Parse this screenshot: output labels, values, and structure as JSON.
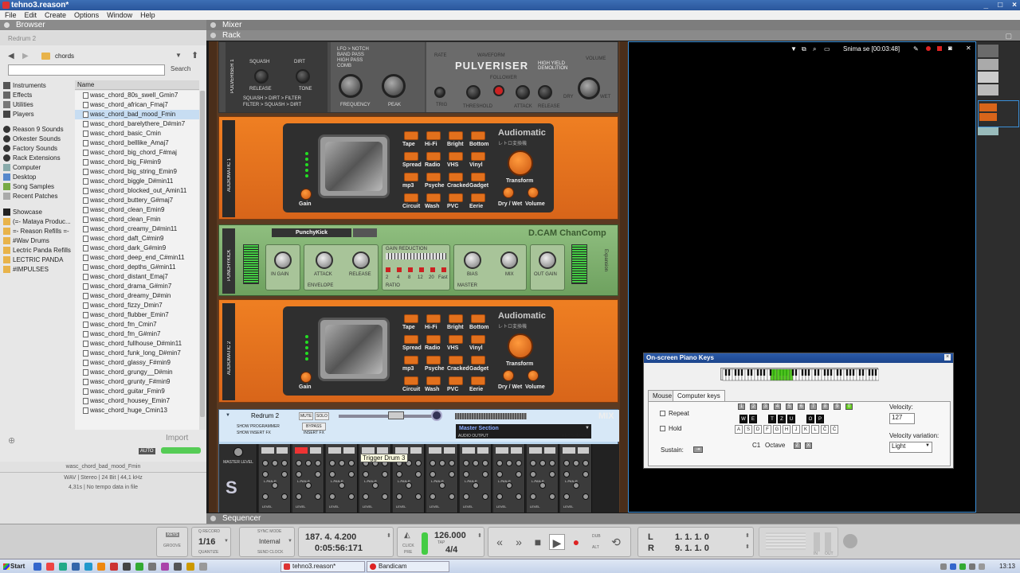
{
  "window": {
    "title": "tehno3.reason*",
    "controls": [
      "_",
      "□",
      "×"
    ]
  },
  "menu": [
    "File",
    "Edit",
    "Create",
    "Options",
    "Window",
    "Help"
  ],
  "browser": {
    "header": "Browser",
    "device_name": "Redrum 2",
    "current_folder": "chords",
    "search_placeholder": "",
    "search_label": "Search",
    "locations": [
      {
        "label": "Instruments",
        "icon": "instruments-icon"
      },
      {
        "label": "Effects",
        "icon": "effects-icon"
      },
      {
        "label": "Utilities",
        "icon": "utilities-icon"
      },
      {
        "label": "Players",
        "icon": "players-icon"
      },
      {
        "label": "Reason 9 Sounds",
        "icon": "soundbank-icon"
      },
      {
        "label": "Orkester Sounds",
        "icon": "soundbank-icon"
      },
      {
        "label": "Factory Sounds",
        "icon": "soundbank-icon"
      },
      {
        "label": "Rack Extensions",
        "icon": "rack-extensions-icon"
      },
      {
        "label": "Computer",
        "icon": "computer-icon"
      },
      {
        "label": "Desktop",
        "icon": "desktop-icon"
      },
      {
        "label": "Song Samples",
        "icon": "song-icon"
      },
      {
        "label": "Recent Patches",
        "icon": "recent-icon"
      },
      {
        "label": "Showcase",
        "icon": "showcase-icon"
      },
      {
        "label": "(=- Mataya Produc...",
        "icon": "folder-icon"
      },
      {
        "label": "=- Reason Refills =-",
        "icon": "folder-icon"
      },
      {
        "label": "#Wav Drums",
        "icon": "folder-icon"
      },
      {
        "label": "Lectric Panda Refills",
        "icon": "folder-icon"
      },
      {
        "label": "LECTRIC PANDA",
        "icon": "folder-icon"
      },
      {
        "label": "#IMPULSES",
        "icon": "folder-icon"
      }
    ],
    "file_column_header": "Name",
    "files": [
      "wasc_chord_80s_swell_Gmin7",
      "wasc_chord_african_Fmaj7",
      "wasc_chord_bad_mood_Fmin",
      "wasc_chord_barelythere_D#min7",
      "wasc_chord_basic_Cmin",
      "wasc_chord_belllike_Amaj7",
      "wasc_chord_big_chord_F#maj",
      "wasc_chord_big_F#min9",
      "wasc_chord_big_string_Emin9",
      "wasc_chord_biggle_D#min11",
      "wasc_chord_blocked_out_Amin11",
      "wasc_chord_buttery_G#maj7",
      "wasc_chord_clean_Emin9",
      "wasc_chord_clean_Fmin",
      "wasc_chord_creamy_D#min11",
      "wasc_chord_daft_C#min9",
      "wasc_chord_dark_G#min9",
      "wasc_chord_deep_end_C#min11",
      "wasc_chord_depths_G#min11",
      "wasc_chord_distant_Emaj7",
      "wasc_chord_drama_G#min7",
      "wasc_chord_dreamy_D#min",
      "wasc_chord_fizzy_Dmin7",
      "wasc_chord_flubber_Emin7",
      "wasc_chord_fm_Cmin7",
      "wasc_chord_fm_G#min7",
      "wasc_chord_fullhouse_D#min11",
      "wasc_chord_funk_long_D#min7",
      "wasc_chord_glassy_F#min9",
      "wasc_chord_grungy__D#min",
      "wasc_chord_grunty_F#min9",
      "wasc_chord_guitar_Fmin9",
      "wasc_chord_housey_Emin7",
      "wasc_chord_huge_Cmin13"
    ],
    "selected_index": 2,
    "import_label": "Import",
    "auto_label": "AUTO",
    "selected_file": "wasc_chord_bad_mood_Fmin",
    "file_format": "WAV | Stereo | 24 Bit | 44,1 kHz",
    "file_length": "4,31s | No tempo data in file"
  },
  "panels": {
    "mixer": "Mixer",
    "rack": "Rack",
    "sequencer": "Sequencer"
  },
  "rack": {
    "pulveriser": {
      "name": "PULVERISER",
      "sub": "HIGH YIELD DEMOLITION",
      "side": "PULVERISER 1",
      "labels": [
        "SQUASH",
        "DIRT",
        "RELEASE",
        "TONE",
        "LFO > NOTCH",
        "BAND PASS",
        "HIGH PASS",
        "COMB",
        "FREQUENCY",
        "PEAK",
        "RATE",
        "WAVEFORM",
        "FOLLOWER",
        "THRESHOLD",
        "ATTACK",
        "RELEASE",
        "DRY",
        "WET",
        "VOLUME",
        "TRIG",
        "SQUASH > DIRT > FILTER",
        "FILTER > SQUASH > DIRT"
      ]
    },
    "audiomatic_1": {
      "side": "AUDIOMATIC 1",
      "brand": "Audiomatic",
      "brand_sub": "レトロ変換機",
      "presets": [
        "Tape",
        "Hi-Fi",
        "Bright",
        "Bottom",
        "Spread",
        "Radio",
        "VHS",
        "Vinyl",
        "mp3",
        "Psyche",
        "Cracked",
        "Gadget",
        "Circuit",
        "Wash",
        "PVC",
        "Eerie"
      ],
      "controls": [
        "Gain",
        "Transform",
        "Dry / Wet",
        "Volume"
      ]
    },
    "compressor": {
      "side": "PUNCHYKICK",
      "preset": "PunchyKick",
      "brand": "D.CAM ChanComp",
      "knobs": [
        "IN GAIN",
        "ATTACK",
        "RELEASE",
        "BIAS",
        "MIX",
        "OUT GAIN"
      ],
      "sections": [
        "ENVELOPE",
        "RATIO",
        "MASTER"
      ],
      "ratio_values": [
        "2",
        "4",
        "8",
        "12",
        "20",
        "Fast"
      ],
      "meter_label": "GAIN REDUCTION",
      "expansion": "Expansion"
    },
    "audiomatic_2": {
      "side": "AUDIOMATIC 2",
      "brand": "Audiomatic",
      "brand_sub": "レトロ変換機",
      "presets": [
        "Tape",
        "Hi-Fi",
        "Bright",
        "Bottom",
        "Spread",
        "Radio",
        "VHS",
        "Vinyl",
        "mp3",
        "Psyche",
        "Cracked",
        "Gadget",
        "Circuit",
        "Wash",
        "PVC",
        "Eerie"
      ],
      "controls": [
        "Gain",
        "Transform",
        "Dry / Wet",
        "Volume"
      ]
    },
    "mixer": {
      "device_name": "Redrum 2",
      "mute": "MUTE",
      "solo": "SOLO",
      "show_programmer": "SHOW PROGRAMMER",
      "show_insert": "SHOW INSERT FX",
      "bypass": "BYPASS",
      "inserts": "INSERT FX",
      "mix_label": "MIX",
      "master_section": "Master Section",
      "audio_output": "AUDIO OUTPUT",
      "rec_source": "REC SOURCE",
      "master_level": "MASTER LEVEL",
      "channel_labels": [
        "S1",
        "S2",
        "L-PAN-R",
        "LEVEL",
        "VEL"
      ],
      "channel_count": 10
    }
  },
  "tooltip": "Trigger Drum 3",
  "recorder": {
    "label": "Snima se [00:03:48]"
  },
  "piano_keys": {
    "title": "On-screen Piano Keys",
    "tabs": [
      "Mouse",
      "Computer keys"
    ],
    "active_tab": "Computer keys",
    "repeat": "Repeat",
    "hold": "Hold",
    "sustain": "Sustain:",
    "sustain_key": "Tab",
    "velocity_label": "Velocity:",
    "velocity": "127",
    "velocity_variation_label": "Velocity variation:",
    "velocity_variation": "Light",
    "octave_label": "Octave",
    "octave_note": "C1",
    "octave_minus": "Z",
    "octave_plus": "X",
    "octave_buttons": [
      "1",
      "2",
      "3",
      "4",
      "5",
      "6",
      "7",
      "8",
      "9",
      "0"
    ],
    "active_octave": "0",
    "black_keys": [
      "W",
      "E",
      "T",
      "Z",
      "U",
      "O",
      "P"
    ],
    "white_keys": [
      "A",
      "S",
      "D",
      "F",
      "G",
      "H",
      "J",
      "K",
      "L",
      "Č",
      "Ć"
    ]
  },
  "transport": {
    "keys_label": "KEYS",
    "groove_label": "GROOVE",
    "q_record": "Q RECORD",
    "quantize_value": "1/16",
    "quantize_label": "QUANTIZE",
    "sync_mode_label": "SYNC MODE",
    "sync_mode": "Internal",
    "send_clock": "SEND CLOCK",
    "position_bars": "187.  4.  4.200",
    "position_time": "0:05:56:171",
    "click_label": "CLICK",
    "pre_label": "PRE",
    "tempo": "126.000",
    "tap_label": "TAP",
    "time_signature": "4/4",
    "dub": "DUB",
    "alt": "ALT",
    "loop_left_label": "L",
    "loop_right_label": "R",
    "loop_left": "1.  1.  1.    0",
    "loop_right": "9.  1.  1.    0",
    "in_label": "IN",
    "out_label": "OUT"
  },
  "taskbar": {
    "start": "Start",
    "tasks": [
      "tehno3.reason*",
      "Bandicam"
    ],
    "clock": "13:13"
  }
}
